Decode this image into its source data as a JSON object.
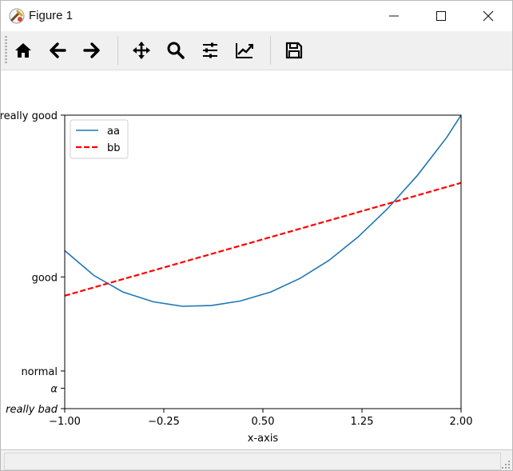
{
  "window": {
    "title": "Figure 1",
    "app_icon": "matplotlib-tools-icon",
    "controls": [
      "minimize-icon",
      "maximize-icon",
      "close-icon"
    ]
  },
  "toolbar": {
    "buttons": [
      {
        "name": "home",
        "icon": "home-icon"
      },
      {
        "name": "back",
        "icon": "arrow-left-icon"
      },
      {
        "name": "forward",
        "icon": "arrow-right-icon"
      },
      {
        "name": "pan",
        "icon": "move-icon"
      },
      {
        "name": "zoom",
        "icon": "magnifier-icon"
      },
      {
        "name": "configure-subplots",
        "icon": "sliders-icon"
      },
      {
        "name": "edit-axis",
        "icon": "line-chart-icon"
      },
      {
        "name": "save",
        "icon": "floppy-disk-icon"
      }
    ]
  },
  "chart_data": {
    "type": "line",
    "title": "",
    "xlabel": "x-axis",
    "ylabel": "",
    "xlim": [
      -1.0,
      2.0
    ],
    "ylim": [
      -2,
      1
    ],
    "x_ticks": [
      {
        "value": -1.0,
        "label": "−1.00"
      },
      {
        "value": -0.25,
        "label": "−0.25"
      },
      {
        "value": 0.5,
        "label": "0.50"
      },
      {
        "value": 1.25,
        "label": "1.25"
      },
      {
        "value": 2.0,
        "label": "2.00"
      }
    ],
    "y_ticks": [
      {
        "value": -2,
        "label": "really bad"
      },
      {
        "value": -1.8,
        "label": "α"
      },
      {
        "value": -1,
        "label": "normal"
      },
      {
        "value": 0.22,
        "label": "good"
      },
      {
        "value": 3,
        "label": "really good"
      }
    ],
    "y_ticks_note_positions": [
      -2,
      -1.73,
      -1.5,
      -0.25,
      1.22
    ],
    "grid": false,
    "legend_position": "upper-left",
    "series": [
      {
        "name": "aa",
        "color": "#1f77b4",
        "style": "solid",
        "x": [
          -1.0,
          -0.78,
          -0.56,
          -0.33,
          -0.11,
          0.11,
          0.33,
          0.56,
          0.78,
          1.0,
          1.22,
          1.44,
          1.67,
          1.89,
          2.0
        ],
        "y": [
          0.1,
          -0.23,
          -0.45,
          -0.58,
          -0.64,
          -0.63,
          -0.57,
          -0.45,
          -0.27,
          -0.03,
          0.28,
          0.65,
          1.1,
          1.6,
          1.9
        ]
      },
      {
        "name": "bb",
        "color": "#ff0000",
        "style": "dashed",
        "x": [
          -1.0,
          2.0
        ],
        "y": [
          -0.5,
          1.0
        ]
      }
    ]
  }
}
